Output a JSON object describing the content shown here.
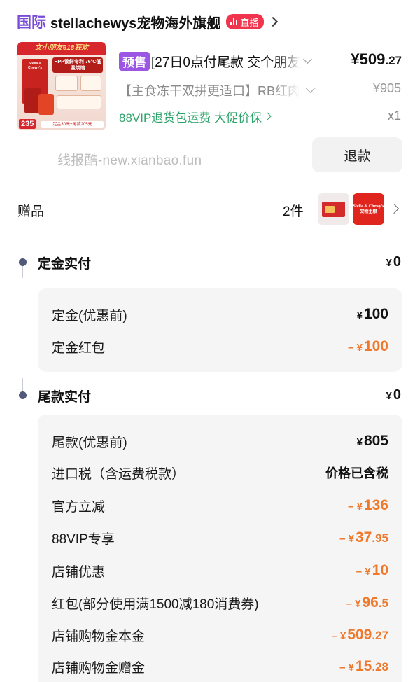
{
  "header": {
    "tag": "国际",
    "store_name": "stellachewys宠物海外旗舰",
    "live_label": "直播"
  },
  "product": {
    "image": {
      "banner": "文小朋友618狂欢",
      "brand": "Stella & Chewy's",
      "headline": "HPP锁鲜专利 76°C低温烘焙",
      "price": "235",
      "note": "定金30元+尾款205元"
    },
    "presale_badge": "预售",
    "title": "[27日0点付尾款 交个朋友",
    "sku": "【主食冻干双拼更适口】RB红肉",
    "vip_text": "88VIP退货包运费  大促价保",
    "price_int": "¥509",
    "price_dec": ".27",
    "orig_price": "¥905",
    "quantity": "x1"
  },
  "watermark": "线报酷-new.xianbao.fun",
  "refund_button": "退款",
  "gifts": {
    "label": "赠品",
    "count": "2件",
    "thumb2_text": "Stella & Chewy's 宠物主粮"
  },
  "deposit": {
    "title": "定金实付",
    "yen": "¥",
    "amount": "0",
    "rows": [
      {
        "label": "定金(优惠前)",
        "prefix": "¥",
        "int": "100",
        "dec": ""
      },
      {
        "label": "定金红包",
        "prefix": "– ¥",
        "int": "100",
        "dec": ""
      }
    ]
  },
  "balance": {
    "title": "尾款实付",
    "yen": "¥",
    "amount": "0",
    "rows": [
      {
        "label": "尾款(优惠前)",
        "prefix": "¥",
        "int": "805",
        "dec": ""
      },
      {
        "label": "进口税（含运费税款）",
        "text": "价格已含税"
      },
      {
        "label": "官方立减",
        "prefix": "– ¥",
        "int": "136",
        "dec": ""
      },
      {
        "label": "88VIP专享",
        "prefix": "– ¥",
        "int": "37",
        "dec": ".95"
      },
      {
        "label": "店铺优惠",
        "prefix": "– ¥",
        "int": "10",
        "dec": ""
      },
      {
        "label": "红包(部分使用满1500减180消费券)",
        "prefix": "– ¥",
        "int": "96",
        "dec": ".5"
      },
      {
        "label": "店铺购物金本金",
        "prefix": "– ¥",
        "int": "509",
        "dec": ".27"
      },
      {
        "label": "店铺购物金赠金",
        "prefix": "– ¥",
        "int": "15",
        "dec": ".28"
      }
    ]
  },
  "colors": {
    "accent_purple": "#7a4bd6",
    "presale_purple": "#9b57e3",
    "live_red": "#f0344e",
    "discount_orange": "#f0782a",
    "vip_green": "#2da46a"
  }
}
